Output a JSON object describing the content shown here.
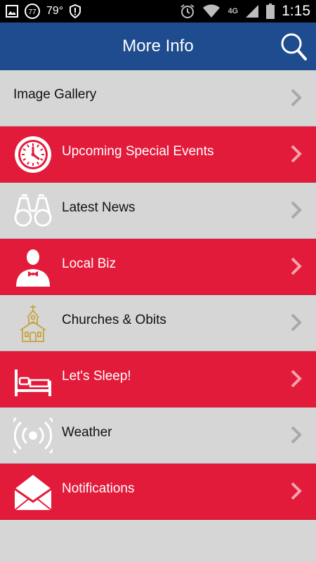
{
  "status_bar": {
    "temperature": "79°",
    "badge": "77",
    "network": "4G",
    "time": "1:15"
  },
  "header": {
    "title": "More Info",
    "search_icon": "search-icon"
  },
  "colors": {
    "header_blue": "#1f4b8f",
    "accent_red": "#e31b3b",
    "row_gray": "#d6d6d6"
  },
  "menu": {
    "items": [
      {
        "label": "Image Gallery",
        "icon": "none",
        "style": "gray"
      },
      {
        "label": "Upcoming Special Events",
        "icon": "clock-icon",
        "style": "red"
      },
      {
        "label": "Latest News",
        "icon": "binoculars-icon",
        "style": "gray"
      },
      {
        "label": "Local Biz",
        "icon": "businessman-icon",
        "style": "red"
      },
      {
        "label": "Churches & Obits",
        "icon": "church-icon",
        "style": "gray"
      },
      {
        "label": "Let's Sleep!",
        "icon": "bed-icon",
        "style": "red"
      },
      {
        "label": "Weather",
        "icon": "broadcast-icon",
        "style": "gray"
      },
      {
        "label": "Notifications",
        "icon": "envelope-icon",
        "style": "red"
      }
    ]
  }
}
